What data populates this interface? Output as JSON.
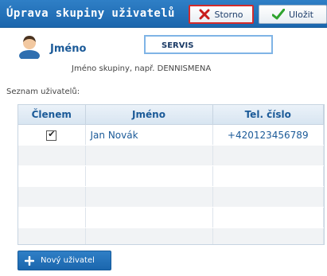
{
  "header": {
    "title": "Úprava skupiny uživatelů",
    "cancel_label": "Storno",
    "save_label": "Uložit"
  },
  "form": {
    "name_label": "Jméno",
    "name_value": "SERVIS",
    "hint": "Jméno skupiny, např. DENNISMENA",
    "list_label": "Seznam uživatelů:"
  },
  "table": {
    "columns": [
      "Členem",
      "Jméno",
      "Tel. číslo"
    ],
    "rows": [
      {
        "member": true,
        "name": "Jan Novák",
        "phone": "+420123456789"
      }
    ]
  },
  "footer": {
    "new_user_label": "Nový uživatel"
  },
  "colors": {
    "accent": "#1b66ad",
    "cancel_border": "#d22b2b"
  },
  "icons": {
    "cancel": "close-x-icon",
    "save": "checkmark-icon",
    "avatar": "user-avatar-icon",
    "new": "plus-icon"
  }
}
